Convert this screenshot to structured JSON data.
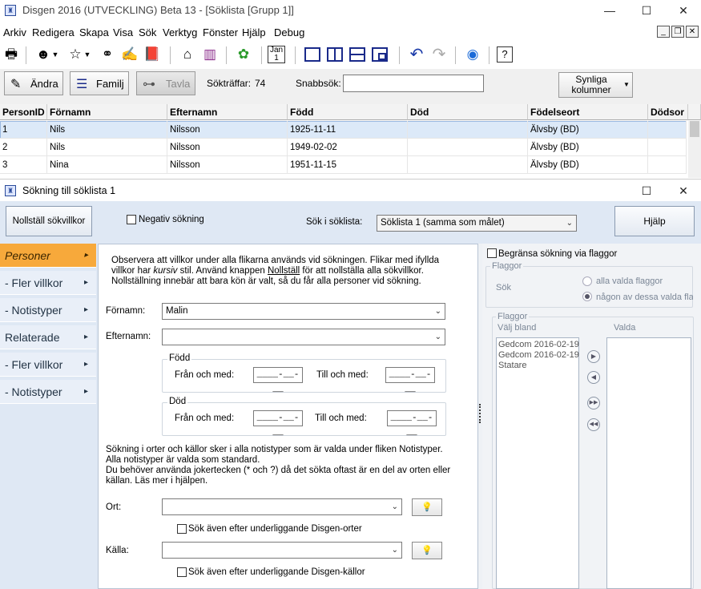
{
  "window": {
    "title": "Disgen 2016 (UTVECKLING) Beta 13 - [Söklista [Grupp 1]]",
    "icon": "disgen-logo-icon"
  },
  "menu": [
    "Arkiv",
    "Redigera",
    "Skapa",
    "Visa",
    "Sök",
    "Verktyg",
    "Fönster",
    "Hjälp",
    "Debug"
  ],
  "toolbar_row2": {
    "andra": "Ändra",
    "familj": "Familj",
    "tavla": "Tavla",
    "sokt_label": "Sökträffar:",
    "sokt_value": "74",
    "snabbsok_label": "Snabbsök:",
    "snabbsok_value": "",
    "synliga": "Synliga kolumner"
  },
  "grid": {
    "headers": [
      "PersonID",
      "Förnamn",
      "Efternamn",
      "Född",
      "Död",
      "Födelseort",
      "Dödsor"
    ],
    "rows": [
      [
        "1",
        "Nils",
        "Nilsson",
        "1925-11-11",
        "",
        "Älvsby (BD)",
        ""
      ],
      [
        "2",
        "Nils",
        "Nilsson",
        "1949-02-02",
        "",
        "Älvsby (BD)",
        ""
      ],
      [
        "3",
        "Nina",
        "Nilsson",
        "1951-11-15",
        "",
        "Älvsby (BD)",
        ""
      ]
    ]
  },
  "dialog": {
    "title": "Sökning till söklista 1",
    "reset_button": "Nollställ sökvillkor",
    "negativ": "Negativ sökning",
    "sok_i_label": "Sök i söklista:",
    "sok_i_value": "Söklista 1 (samma som målet)",
    "help_button": "Hjälp",
    "tabs": [
      "Personer",
      "- Fler villkor",
      "- Notistyper",
      "Relaterade",
      "- Fler villkor",
      "- Notistyper"
    ],
    "info1": "Observera att villkor under alla flikarna används vid sökningen. Flikar med ifyllda",
    "info2a": "villkor har ",
    "info2b": "kursiv",
    "info2c": " stil. Använd knappen ",
    "info2d": "Nollställ",
    "info2e": " för att nollställa alla sökvillkor.",
    "info3": "Nollställning innebär att bara kön är valt, så du får alla personer vid sökning.",
    "fornamn_label": "Förnamn:",
    "fornamn_value": "Malin",
    "efternamn_label": "Efternamn:",
    "efternamn_value": "",
    "fodd_group": "Född",
    "dod_group": "Död",
    "fran": "Från och med:",
    "till": "Till och med:",
    "date_mask": "____-__-__",
    "ort_info1": "Sökning i orter och källor sker i alla notistyper som är valda under fliken Notistyper.",
    "ort_info2": "Alla notistyper är valda som standard.",
    "ort_info3": "Du behöver använda jokertecken (* och ?) då det sökta oftast är en del av orten eller",
    "ort_info4": "källan. Läs mer i hjälpen.",
    "ort_label": "Ort:",
    "ort_value": "",
    "ort_check": "Sök även efter underliggande Disgen-orter",
    "kalla_label": "Källa:",
    "kalla_value": "",
    "kalla_check": "Sök även efter underliggande Disgen-källor",
    "begransa": "Begränsa sökning via flaggor",
    "flaggor1": "Flaggor",
    "sok": "Sök",
    "radio1": "alla valda flaggor",
    "radio2": "någon av dessa valda flaggor",
    "flaggor2": "Flaggor",
    "valj_bland": "Välj bland",
    "valda": "Valda",
    "flag_items": [
      "Gedcom 2016-02-19",
      "Gedcom 2016-02-19",
      "Statare"
    ]
  }
}
